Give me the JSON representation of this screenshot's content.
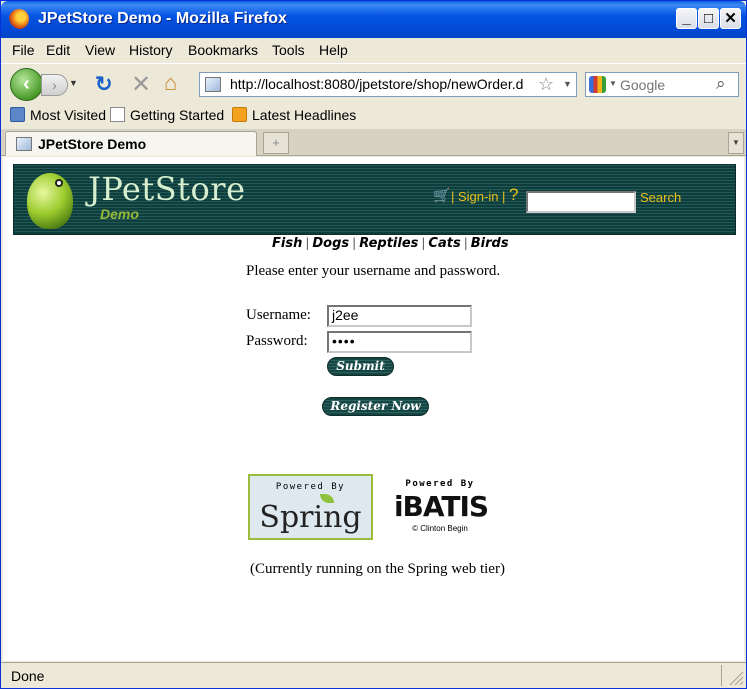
{
  "window": {
    "title": "JPetStore Demo - Mozilla Firefox"
  },
  "menu": [
    "File",
    "Edit",
    "View",
    "History",
    "Bookmarks",
    "Tools",
    "Help"
  ],
  "nav": {
    "url": "http://localhost:8080/jpetstore/shop/newOrder.d",
    "search_placeholder": "Google"
  },
  "bookmarks": [
    "Most Visited",
    "Getting Started",
    "Latest Headlines"
  ],
  "tab": {
    "title": "JPetStore Demo",
    "new_tab": "+"
  },
  "banner": {
    "logo": "JPetStore",
    "logo_sub": "Demo",
    "signin": "Sign-in",
    "search_label": "Search"
  },
  "categories": [
    "Fish",
    "Dogs",
    "Reptiles",
    "Cats",
    "Birds"
  ],
  "form": {
    "prompt": "Please enter your username and password.",
    "username_label": "Username:",
    "username_value": "j2ee",
    "password_label": "Password:",
    "password_value": "••••",
    "submit_label": "Submit",
    "register_label": "Register Now"
  },
  "logos": {
    "spring_powered": "Powered By",
    "spring_name": "Spring",
    "ibatis_powered": "Powered By",
    "ibatis_name": "iBATIS",
    "ibatis_credit": "© Clinton Begin"
  },
  "footer_note": "(Currently running on the Spring web tier)",
  "status": "Done",
  "colors": {
    "titlebar": "#0554e3",
    "banner_bg": "#0e3d3c",
    "banner_link": "#e8c11c",
    "spring_green": "#9cbd3b"
  }
}
